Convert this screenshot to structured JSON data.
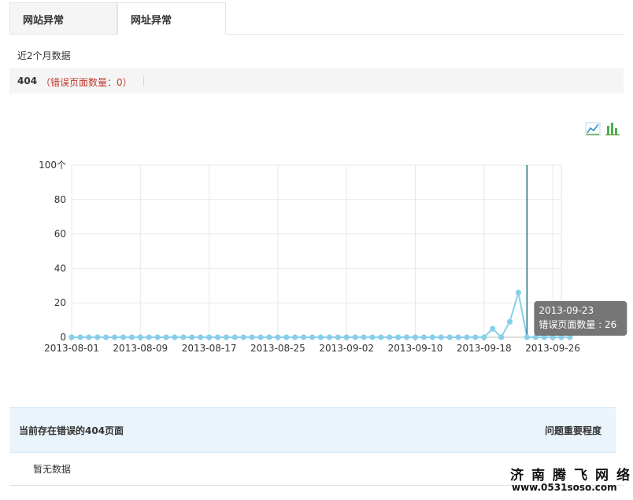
{
  "tabs": [
    {
      "label": "网站异常",
      "active": false
    },
    {
      "label": "网址异常",
      "active": true
    }
  ],
  "period_label": "近2个月数据",
  "error_summary": {
    "code": "404",
    "count_text": "（错误页面数量：0）"
  },
  "chart_controls": {
    "line_icon": "line-chart-icon",
    "bar_icon": "bar-chart-icon"
  },
  "colors": {
    "series": "#87cfe8",
    "crosshair": "#1d6f86",
    "error_text": "#c0392b",
    "table_header": "#eaf4fc"
  },
  "chart_data": {
    "type": "line",
    "title": "",
    "xlabel": "",
    "ylabel": "",
    "ylim": [
      0,
      100
    ],
    "y_ticks": [
      "0",
      "20",
      "40",
      "60",
      "80",
      "100个"
    ],
    "x_start": "2013-08-01",
    "x_end": "2013-09-27",
    "x_ticks": [
      "2013-08-01",
      "2013-08-09",
      "2013-08-17",
      "2013-08-25",
      "2013-09-02",
      "2013-09-10",
      "2013-09-18",
      "2013-09-26"
    ],
    "grid": true,
    "series": [
      {
        "name": "错误页面数量",
        "values": [
          0,
          0,
          0,
          0,
          0,
          0,
          0,
          0,
          0,
          0,
          0,
          0,
          0,
          0,
          0,
          0,
          0,
          0,
          0,
          0,
          0,
          0,
          0,
          0,
          0,
          0,
          0,
          0,
          0,
          0,
          0,
          0,
          0,
          0,
          0,
          0,
          0,
          0,
          0,
          0,
          0,
          0,
          0,
          0,
          0,
          0,
          0,
          0,
          0,
          5,
          0,
          9,
          26,
          0,
          0,
          0,
          0,
          0,
          0
        ]
      }
    ],
    "highlight": {
      "date": "2013-09-23",
      "value": 26
    },
    "tooltip": {
      "date": "2013-09-23",
      "text": "错误页面数量 : 26"
    }
  },
  "table": {
    "title": "当前存在错误的404页面",
    "right_header": "问题重要程度",
    "empty_text": "暂无数据"
  },
  "watermark": {
    "line1": "济南腾飞网络",
    "line2": "www.0531soso.com"
  }
}
